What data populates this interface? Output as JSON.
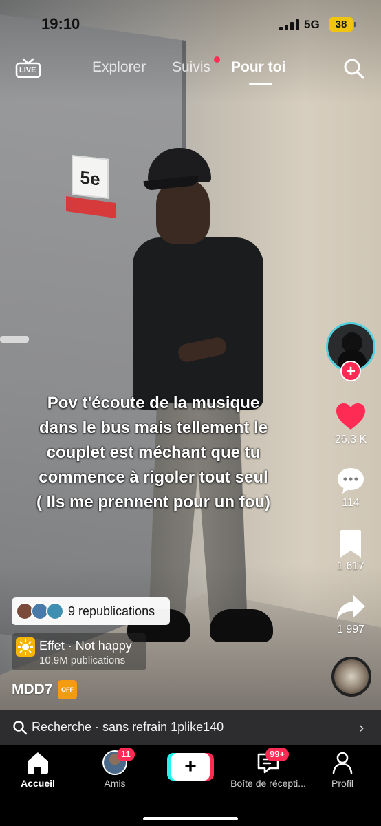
{
  "status_bar": {
    "time": "19:10",
    "network": "5G",
    "battery": "38"
  },
  "top_nav": {
    "live_label": "LIVE",
    "tabs": [
      {
        "label": "Explorer"
      },
      {
        "label": "Suivis"
      },
      {
        "label": "Pour toi"
      }
    ],
    "active_tab": "Pour toi"
  },
  "video": {
    "door_sign": "5e",
    "caption_lines": [
      "Pov t'écoute de la musique",
      "dans le bus mais tellement le",
      "couplet est méchant que tu",
      "commence à rigoler tout seul",
      "( Ils me prennent pour un fou)"
    ]
  },
  "right_rail": {
    "likes": "26,3 K",
    "comments": "114",
    "saves": "1 617",
    "shares": "1 997",
    "follow_label": "+"
  },
  "overlays": {
    "republications": "9 republications",
    "effect_name": "Effet · Not happy",
    "effect_count": "10,9M publications",
    "username": "MDD7",
    "off_badge": "OFF"
  },
  "search_suggestion": {
    "text": "Recherche · sans refrain 1plike140"
  },
  "bottom_nav": {
    "home": "Accueil",
    "friends": "Amis",
    "friends_badge": "11",
    "create": "+",
    "inbox": "Boîte de récepti...",
    "inbox_badge": "99+",
    "profile": "Profil"
  },
  "colors": {
    "accent_pink": "#fe2c55",
    "accent_cyan": "#25f4ee",
    "battery_yellow": "#f1c40f"
  }
}
